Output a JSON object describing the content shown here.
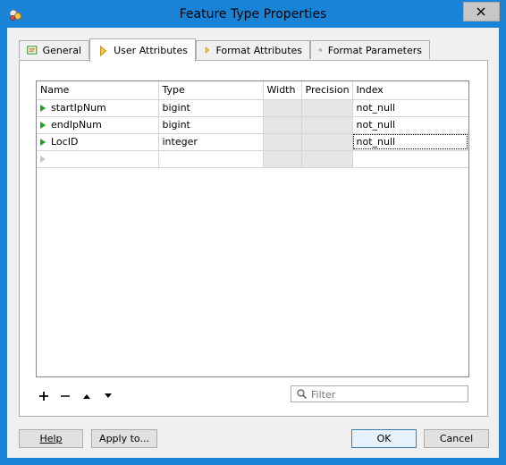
{
  "window": {
    "title": "Feature Type Properties"
  },
  "tabs": [
    {
      "label": "General",
      "icon": "general-icon"
    },
    {
      "label": "User Attributes",
      "icon": "diamond-icon"
    },
    {
      "label": "Format Attributes",
      "icon": "diamond-icon"
    },
    {
      "label": "Format Parameters",
      "icon": "gear-icon"
    }
  ],
  "active_tab": "User Attributes",
  "grid": {
    "columns": [
      "Name",
      "Type",
      "Width",
      "Precision",
      "Index"
    ],
    "rows": [
      {
        "name": "startIpNum",
        "type": "bigint",
        "width": "",
        "precision": "",
        "index": "not_null"
      },
      {
        "name": "endIpNum",
        "type": "bigint",
        "width": "",
        "precision": "",
        "index": "not_null"
      },
      {
        "name": "LocID",
        "type": "integer",
        "width": "",
        "precision": "",
        "index": "not_null"
      }
    ]
  },
  "filter": {
    "placeholder": "Filter"
  },
  "buttons": {
    "help": "Help",
    "apply": "Apply to...",
    "ok": "OK",
    "cancel": "Cancel"
  },
  "colors": {
    "titlebar": "#1883d7",
    "row_marker": "#1aa51a",
    "readonly_cell": "#e6e6e6"
  }
}
